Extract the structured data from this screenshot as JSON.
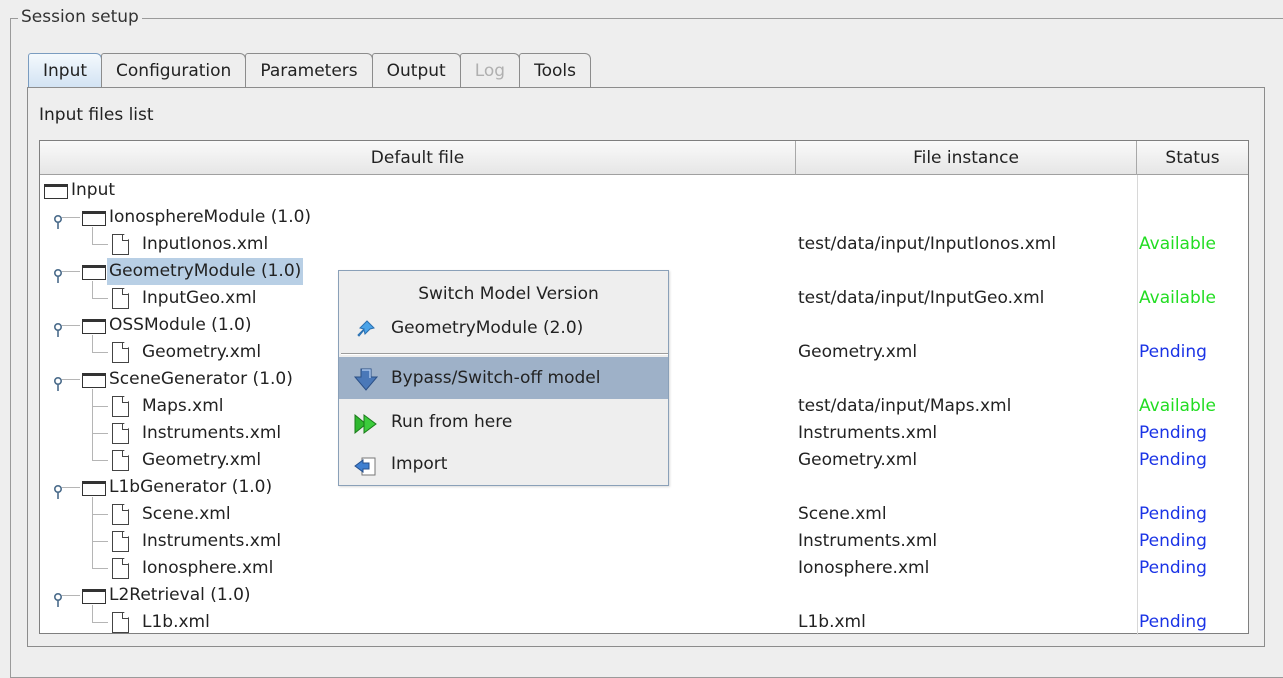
{
  "group": {
    "title": "Session setup"
  },
  "tabs": [
    {
      "label": "Input",
      "active": true
    },
    {
      "label": "Configuration"
    },
    {
      "label": "Parameters"
    },
    {
      "label": "Output"
    },
    {
      "label": "Log",
      "disabled": true
    },
    {
      "label": "Tools"
    }
  ],
  "panel": {
    "label": "Input files list"
  },
  "table": {
    "headers": {
      "default_file": "Default file",
      "file_instance": "File instance",
      "status": "Status"
    },
    "rows": [
      {
        "label": "Input",
        "instance": "",
        "status": ""
      },
      {
        "label": "IonosphereModule (1.0)",
        "instance": "",
        "status": ""
      },
      {
        "label": "InputIonos.xml",
        "instance": "test/data/input/InputIonos.xml",
        "status": "Available"
      },
      {
        "label": "GeometryModule (1.0)",
        "instance": "",
        "status": ""
      },
      {
        "label": "InputGeo.xml",
        "instance": "test/data/input/InputGeo.xml",
        "status": "Available"
      },
      {
        "label": "OSSModule (1.0)",
        "instance": "",
        "status": ""
      },
      {
        "label": "Geometry.xml",
        "instance": "Geometry.xml",
        "status": "Pending"
      },
      {
        "label": "SceneGenerator (1.0)",
        "instance": "",
        "status": ""
      },
      {
        "label": "Maps.xml",
        "instance": "test/data/input/Maps.xml",
        "status": "Available"
      },
      {
        "label": "Instruments.xml",
        "instance": "Instruments.xml",
        "status": "Pending"
      },
      {
        "label": "Geometry.xml",
        "instance": "Geometry.xml",
        "status": "Pending"
      },
      {
        "label": "L1bGenerator (1.0)",
        "instance": "",
        "status": ""
      },
      {
        "label": "Scene.xml",
        "instance": "Scene.xml",
        "status": "Pending"
      },
      {
        "label": "Instruments.xml",
        "instance": "Instruments.xml",
        "status": "Pending"
      },
      {
        "label": "Ionosphere.xml",
        "instance": "Ionosphere.xml",
        "status": "Pending"
      },
      {
        "label": "L2Retrieval (1.0)",
        "instance": "",
        "status": ""
      },
      {
        "label": "L1b.xml",
        "instance": "L1b.xml",
        "status": "Pending"
      }
    ]
  },
  "context_menu": {
    "header": "Switch Model Version",
    "version_item": "GeometryModule (2.0)",
    "bypass": "Bypass/Switch-off model",
    "run_from_here": "Run from here",
    "import": "Import"
  },
  "colors": {
    "available": "#22dd22",
    "pending": "#1a33e6",
    "selection": "#b8cfe5",
    "menu_highlight": "#9eb1c8"
  }
}
